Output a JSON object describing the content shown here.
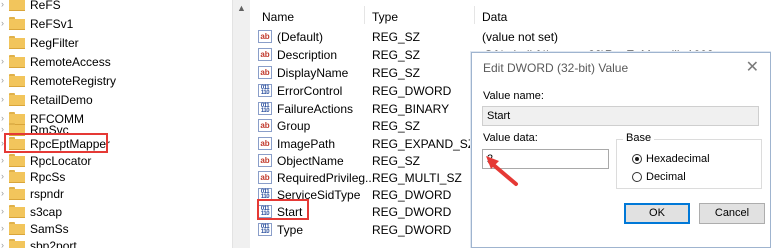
{
  "tree": {
    "items": [
      {
        "label": "ReFS"
      },
      {
        "label": "ReFSv1"
      },
      {
        "label": "RegFilter"
      },
      {
        "label": "RemoteAccess"
      },
      {
        "label": "RemoteRegistry"
      },
      {
        "label": "RetailDemo"
      },
      {
        "label": "RFCOMM"
      },
      {
        "label": "RmSvc"
      },
      {
        "label": "RpcEptMapper"
      },
      {
        "label": "RpcLocator"
      },
      {
        "label": "RpcSs"
      },
      {
        "label": "rspndr"
      },
      {
        "label": "s3cap"
      },
      {
        "label": "SamSs"
      },
      {
        "label": "sbp2port"
      }
    ]
  },
  "values": {
    "headers": {
      "name": "Name",
      "type": "Type",
      "data": "Data"
    },
    "rows": [
      {
        "icon": "ab",
        "name": "(Default)",
        "type": "REG_SZ",
        "data": "(value not set)"
      },
      {
        "icon": "ab",
        "name": "Description",
        "type": "REG_SZ",
        "data": "@%windir%\\system32\\RpcEpMap.dll,-1002"
      },
      {
        "icon": "ab",
        "name": "DisplayName",
        "type": "REG_SZ",
        "data": ""
      },
      {
        "icon": "bin",
        "name": "ErrorControl",
        "type": "REG_DWORD",
        "data": ""
      },
      {
        "icon": "bin",
        "name": "FailureActions",
        "type": "REG_BINARY",
        "data": ""
      },
      {
        "icon": "ab",
        "name": "Group",
        "type": "REG_SZ",
        "data": ""
      },
      {
        "icon": "ab",
        "name": "ImagePath",
        "type": "REG_EXPAND_SZ",
        "data": ""
      },
      {
        "icon": "ab",
        "name": "ObjectName",
        "type": "REG_SZ",
        "data": ""
      },
      {
        "icon": "ab",
        "name": "RequiredPrivileg...",
        "type": "REG_MULTI_SZ",
        "data": ""
      },
      {
        "icon": "bin",
        "name": "ServiceSidType",
        "type": "REG_DWORD",
        "data": ""
      },
      {
        "icon": "bin",
        "name": "Start",
        "type": "REG_DWORD",
        "data": ""
      },
      {
        "icon": "bin",
        "name": "Type",
        "type": "REG_DWORD",
        "data": ""
      }
    ]
  },
  "dialog": {
    "title": "Edit DWORD (32-bit) Value",
    "close_glyph": "✕",
    "value_name_label": "Value name:",
    "value_name": "Start",
    "value_data_label": "Value data:",
    "value_data": "2",
    "base_label": "Base",
    "base_options": [
      {
        "label": "Hexadecimal",
        "selected": true
      },
      {
        "label": "Decimal",
        "selected": false
      }
    ],
    "ok_label": "OK",
    "cancel_label": "Cancel"
  },
  "colors": {
    "highlight": "#e53935",
    "accent": "#0078d7"
  }
}
